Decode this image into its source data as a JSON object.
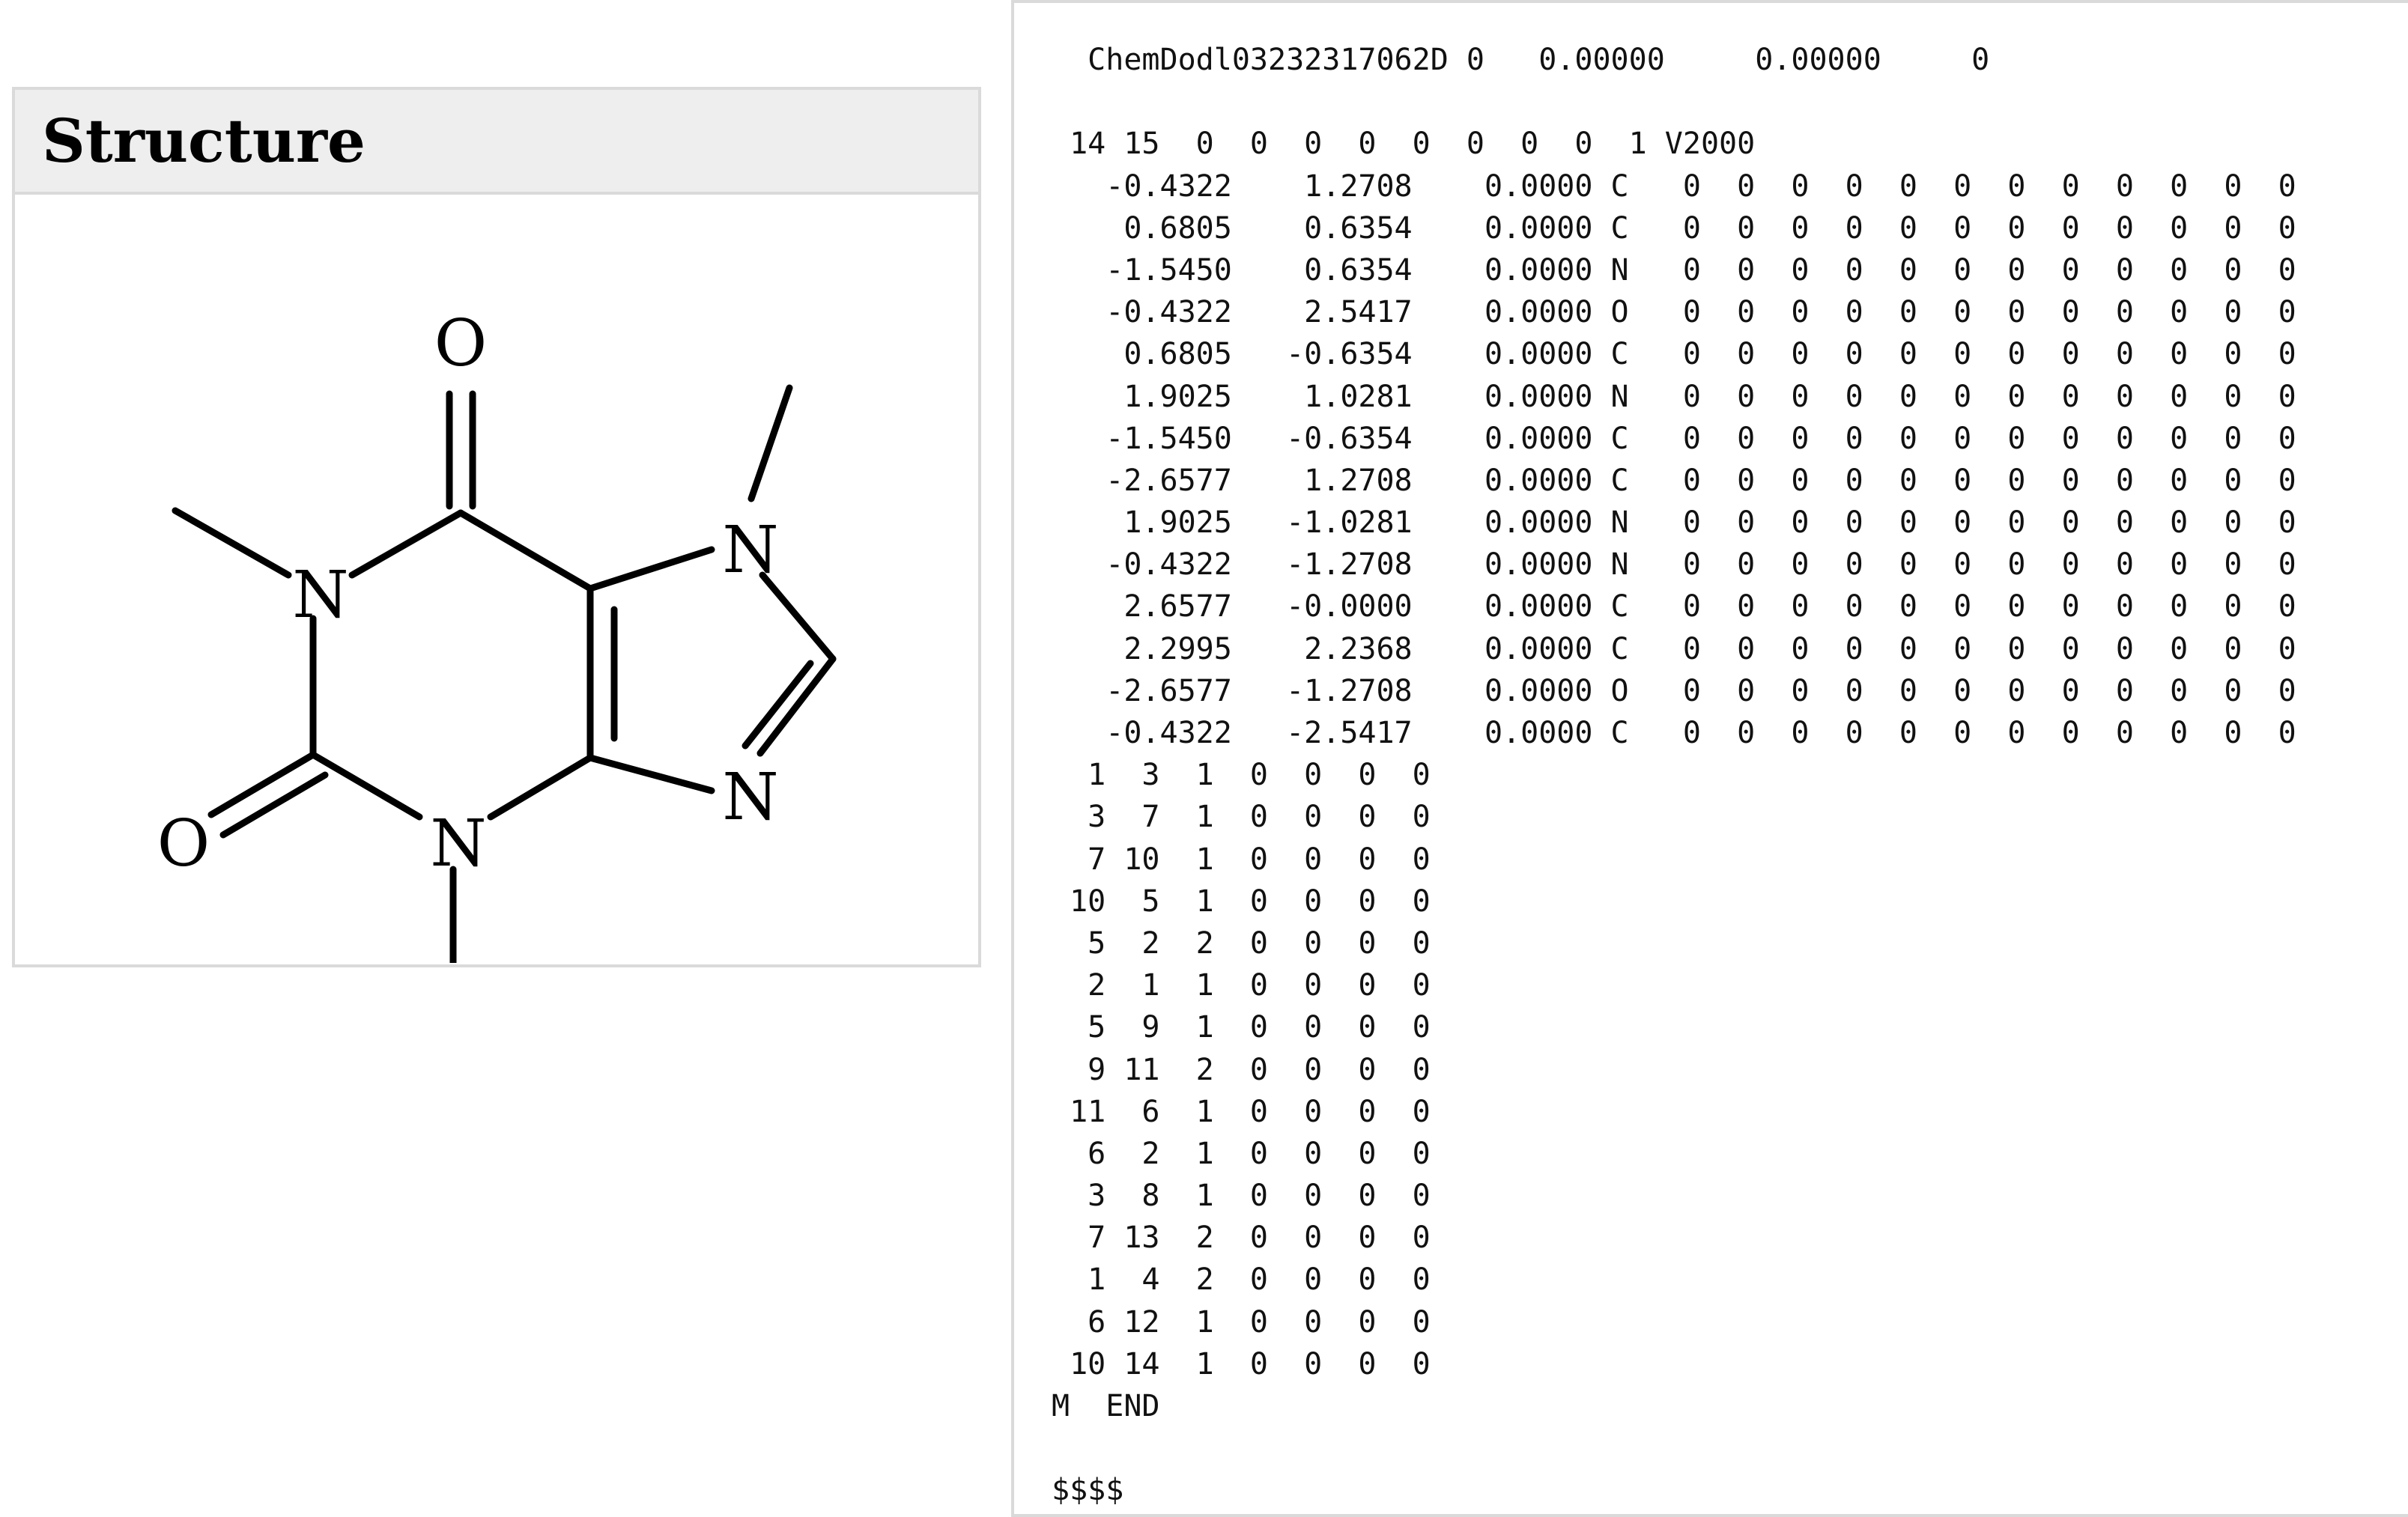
{
  "structure_panel": {
    "title": "Structure",
    "atom_labels": {
      "o_top": "O",
      "n1": "N",
      "n_methyl_top": "N",
      "n_bottom_right": "N",
      "n3": "N",
      "o_left": "O"
    }
  },
  "molfile": {
    "lines": [
      "  ChemDodl03232317062D 0   0.00000     0.00000     0",
      "",
      " 14 15  0  0  0  0  0  0  0  0  1 V2000",
      "   -0.4322    1.2708    0.0000 C   0  0  0  0  0  0  0  0  0  0  0  0",
      "    0.6805    0.6354    0.0000 C   0  0  0  0  0  0  0  0  0  0  0  0",
      "   -1.5450    0.6354    0.0000 N   0  0  0  0  0  0  0  0  0  0  0  0",
      "   -0.4322    2.5417    0.0000 O   0  0  0  0  0  0  0  0  0  0  0  0",
      "    0.6805   -0.6354    0.0000 C   0  0  0  0  0  0  0  0  0  0  0  0",
      "    1.9025    1.0281    0.0000 N   0  0  0  0  0  0  0  0  0  0  0  0",
      "   -1.5450   -0.6354    0.0000 C   0  0  0  0  0  0  0  0  0  0  0  0",
      "   -2.6577    1.2708    0.0000 C   0  0  0  0  0  0  0  0  0  0  0  0",
      "    1.9025   -1.0281    0.0000 N   0  0  0  0  0  0  0  0  0  0  0  0",
      "   -0.4322   -1.2708    0.0000 N   0  0  0  0  0  0  0  0  0  0  0  0",
      "    2.6577   -0.0000    0.0000 C   0  0  0  0  0  0  0  0  0  0  0  0",
      "    2.2995    2.2368    0.0000 C   0  0  0  0  0  0  0  0  0  0  0  0",
      "   -2.6577   -1.2708    0.0000 O   0  0  0  0  0  0  0  0  0  0  0  0",
      "   -0.4322   -2.5417    0.0000 C   0  0  0  0  0  0  0  0  0  0  0  0",
      "  1  3  1  0  0  0  0",
      "  3  7  1  0  0  0  0",
      "  7 10  1  0  0  0  0",
      " 10  5  1  0  0  0  0",
      "  5  2  2  0  0  0  0",
      "  2  1  1  0  0  0  0",
      "  5  9  1  0  0  0  0",
      "  9 11  2  0  0  0  0",
      " 11  6  1  0  0  0  0",
      "  6  2  1  0  0  0  0",
      "  3  8  1  0  0  0  0",
      "  7 13  2  0  0  0  0",
      "  1  4  2  0  0  0  0",
      "  6 12  1  0  0  0  0",
      " 10 14  1  0  0  0  0",
      "M  END",
      "",
      "$$$$"
    ]
  }
}
